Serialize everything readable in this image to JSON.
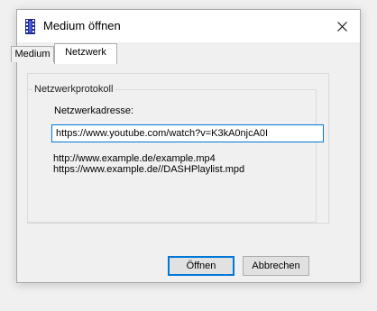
{
  "window": {
    "title": "Medium öffnen",
    "icon": "film-strip-icon",
    "close_icon": "close-icon"
  },
  "tabs": [
    {
      "label": "Medium",
      "active": false
    },
    {
      "label": "Netzwerk",
      "active": true
    }
  ],
  "network": {
    "group_title": "Netzwerkprotokoll",
    "address_label": "Netzwerkadresse:",
    "address_value": "https://www.youtube.com/watch?v=K3kA0njcA0I",
    "examples": [
      "http://www.example.de/example.mp4",
      "https://www.example.de//DASHPlaylist.mpd"
    ]
  },
  "buttons": {
    "open_label": "Öffnen",
    "cancel_label": "Abbrechen"
  },
  "colors": {
    "accent": "#0078d7",
    "icon_blue": "#1f2b8f"
  }
}
